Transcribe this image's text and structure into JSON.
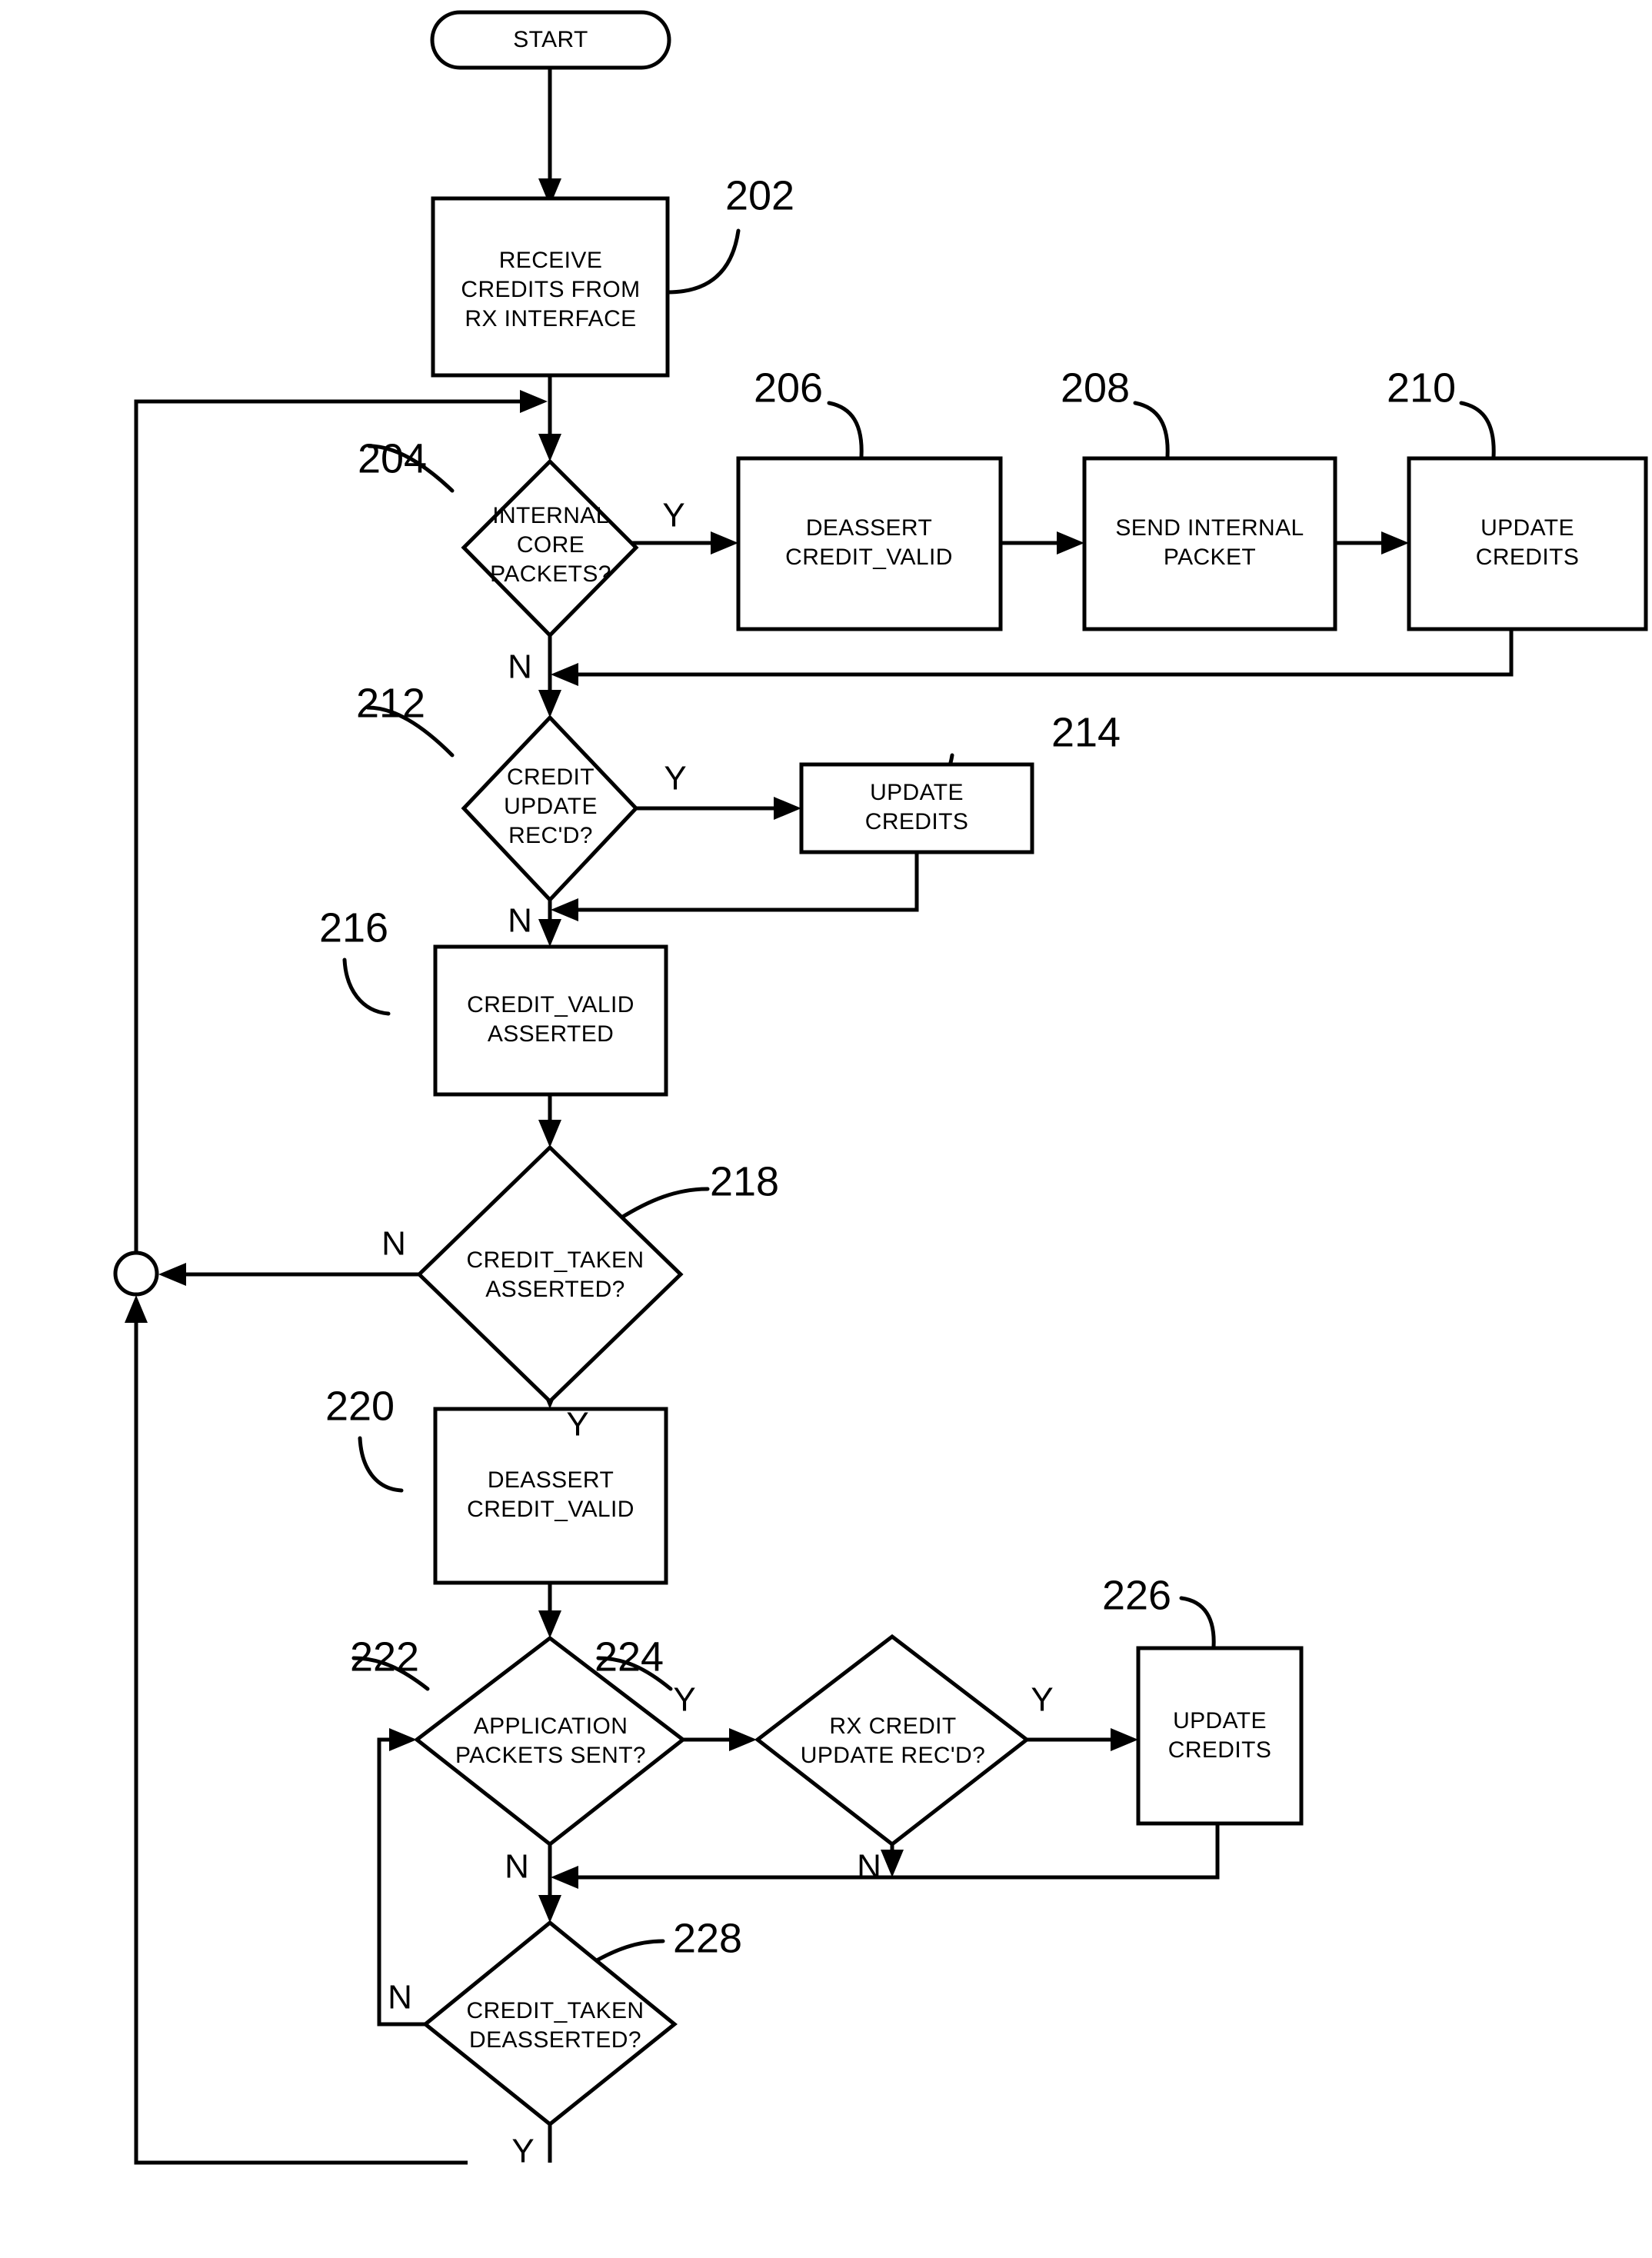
{
  "diagram": {
    "type": "flowchart",
    "title": "Credit flow control process flowchart",
    "start_label": "START",
    "branch_yes": "Y",
    "branch_no": "N",
    "nodes": [
      {
        "id": "start",
        "ref": "",
        "shape": "terminator",
        "text": [
          "START"
        ]
      },
      {
        "id": "n202",
        "ref": "202",
        "shape": "process",
        "text": [
          "RECEIVE",
          "CREDITS FROM",
          "RX INTERFACE"
        ]
      },
      {
        "id": "n204",
        "ref": "204",
        "shape": "decision",
        "text": [
          "INTERNAL",
          "CORE",
          "PACKETS?"
        ]
      },
      {
        "id": "n206",
        "ref": "206",
        "shape": "process",
        "text": [
          "DEASSERT",
          "CREDIT_VALID"
        ]
      },
      {
        "id": "n208",
        "ref": "208",
        "shape": "process",
        "text": [
          "SEND INTERNAL",
          "PACKET"
        ]
      },
      {
        "id": "n210",
        "ref": "210",
        "shape": "process",
        "text": [
          "UPDATE",
          "CREDITS"
        ]
      },
      {
        "id": "n212",
        "ref": "212",
        "shape": "decision",
        "text": [
          "CREDIT",
          "UPDATE",
          "REC'D?"
        ]
      },
      {
        "id": "n214",
        "ref": "214",
        "shape": "process",
        "text": [
          "UPDATE",
          "CREDITS"
        ]
      },
      {
        "id": "n216",
        "ref": "216",
        "shape": "process",
        "text": [
          "CREDIT_VALID",
          "ASSERTED"
        ]
      },
      {
        "id": "n218",
        "ref": "218",
        "shape": "decision",
        "text": [
          "CREDIT_TAKEN",
          "ASSERTED?"
        ]
      },
      {
        "id": "n220",
        "ref": "220",
        "shape": "process",
        "text": [
          "DEASSERT",
          "CREDIT_VALID"
        ]
      },
      {
        "id": "n222",
        "ref": "222",
        "shape": "decision",
        "text": [
          "APPLICATION",
          "PACKETS SENT?"
        ]
      },
      {
        "id": "n224",
        "ref": "224",
        "shape": "decision",
        "text": [
          "RX CREDIT",
          "UPDATE REC'D?"
        ]
      },
      {
        "id": "n226",
        "ref": "226",
        "shape": "process",
        "text": [
          "UPDATE",
          "CREDITS"
        ]
      },
      {
        "id": "n228",
        "ref": "228",
        "shape": "decision",
        "text": [
          "CREDIT_TAKEN",
          "DEASSERTED?"
        ]
      },
      {
        "id": "junction",
        "ref": "",
        "shape": "connector",
        "text": []
      }
    ],
    "edges": [
      {
        "from": "start",
        "to": "n202",
        "label": ""
      },
      {
        "from": "n202",
        "to": "n204",
        "label": ""
      },
      {
        "from": "n204",
        "to": "n206",
        "label": "Y"
      },
      {
        "from": "n204",
        "to": "n212",
        "label": "N"
      },
      {
        "from": "n206",
        "to": "n208",
        "label": ""
      },
      {
        "from": "n208",
        "to": "n210",
        "label": ""
      },
      {
        "from": "n210",
        "to": "n212",
        "label": ""
      },
      {
        "from": "n212",
        "to": "n214",
        "label": "Y"
      },
      {
        "from": "n212",
        "to": "n216",
        "label": "N"
      },
      {
        "from": "n214",
        "to": "n216",
        "label": ""
      },
      {
        "from": "n216",
        "to": "n218",
        "label": ""
      },
      {
        "from": "n218",
        "to": "junction",
        "label": "N"
      },
      {
        "from": "n218",
        "to": "n220",
        "label": "Y"
      },
      {
        "from": "n220",
        "to": "n222",
        "label": ""
      },
      {
        "from": "n222",
        "to": "n224",
        "label": "Y"
      },
      {
        "from": "n222",
        "to": "n228",
        "label": "N"
      },
      {
        "from": "n224",
        "to": "n226",
        "label": "Y"
      },
      {
        "from": "n224",
        "to": "n228",
        "label": "N"
      },
      {
        "from": "n226",
        "to": "n228",
        "label": ""
      },
      {
        "from": "n228",
        "to": "n222",
        "label": "N"
      },
      {
        "from": "n228",
        "to": "junction",
        "label": "Y"
      },
      {
        "from": "junction",
        "to": "n204",
        "label": ""
      }
    ]
  },
  "colors": {
    "stroke": "#000000",
    "fill": "#ffffff",
    "background": "#ffffff"
  }
}
